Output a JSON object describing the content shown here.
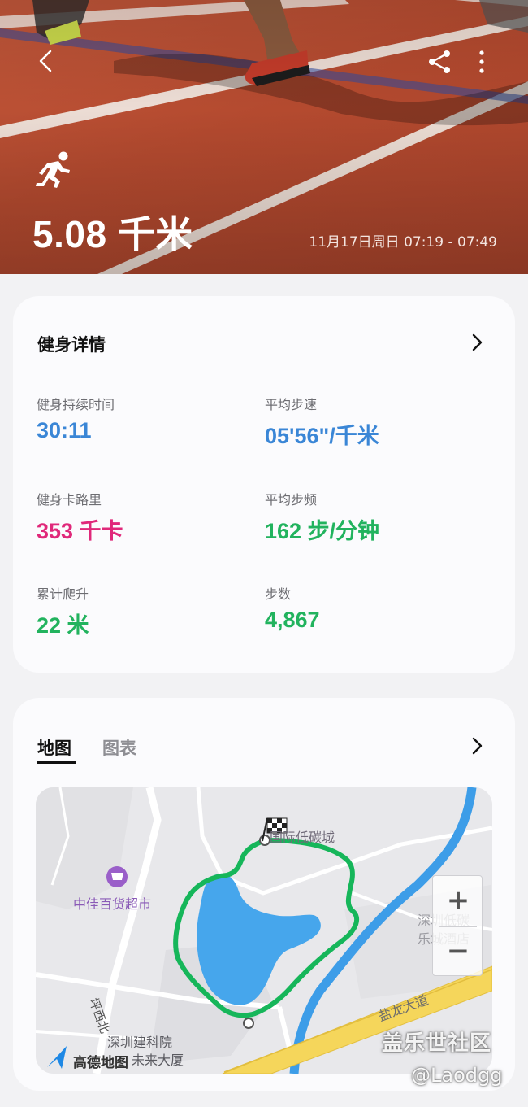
{
  "hero": {
    "distance": "5.08 千米",
    "session_time": "11月17日周日 07:19 - 07:49",
    "back_icon": "chevron-left-icon",
    "share_icon": "share-icon",
    "more_icon": "more-vertical-icon",
    "activity_icon": "running-icon"
  },
  "details": {
    "title": "健身详情",
    "metrics": [
      {
        "label": "健身持续时间",
        "value": "30:11",
        "color": "#3a86d6"
      },
      {
        "label": "平均步速",
        "value": "05'56\"/千米",
        "color": "#3a86d6"
      },
      {
        "label": "健身卡路里",
        "value": "353 千卡",
        "color": "#e0287a"
      },
      {
        "label": "平均步频",
        "value": "162 步/分钟",
        "color": "#22b35e"
      },
      {
        "label": "累计爬升",
        "value": "22 米",
        "color": "#22b35e"
      },
      {
        "label": "步数",
        "value": "4,867",
        "color": "#22b35e"
      }
    ]
  },
  "map_card": {
    "tabs": [
      {
        "label": "地图",
        "active": true
      },
      {
        "label": "图表",
        "active": false
      }
    ],
    "map": {
      "labels": {
        "poi_top": "国际低碳城",
        "poi_shop": "中佳百货超市",
        "poi_hotel_1": "深圳低碳",
        "poi_hotel_2": "乐城酒店",
        "road_main": "盐龙大道",
        "road_side": "坪西北",
        "poi_bottom_1": "深圳建科院",
        "poi_bottom_2": "未来大厦",
        "provider": "高德地图"
      },
      "zoom_in": "+",
      "zoom_out": "−",
      "route_color": "#16b65a",
      "water_color": "#46a6ec"
    }
  },
  "watermark": {
    "line1": "盖乐世社区",
    "line2": "@Laodgg"
  }
}
